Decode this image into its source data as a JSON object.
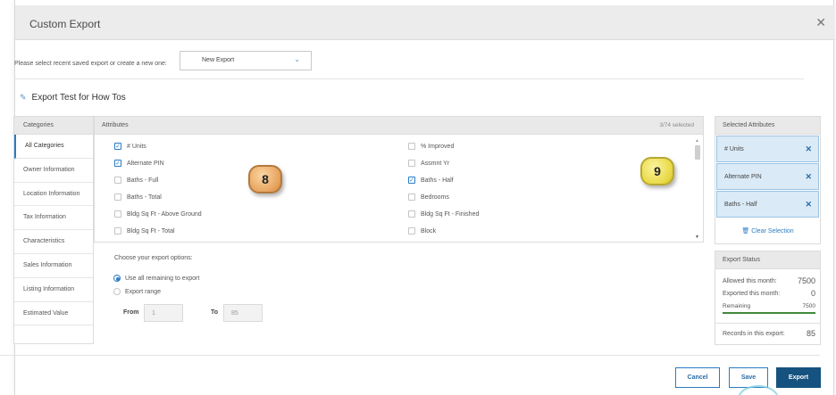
{
  "dialog": {
    "title": "Custom Export"
  },
  "select_row": {
    "prompt": "Please select recent saved export or create a new one:",
    "selected": "New Export"
  },
  "export_name": "Export Test for How Tos",
  "categories": {
    "header": "Categories",
    "items": [
      "All Categories",
      "Owner Information",
      "Location Information",
      "Tax Information",
      "Characteristics",
      "Sales Information",
      "Listing Information",
      "Estimated Value"
    ]
  },
  "attributes": {
    "header": "Attributes",
    "count": "3/74 selected",
    "left": [
      {
        "label": "# Units",
        "checked": true
      },
      {
        "label": "Alternate PIN",
        "checked": true
      },
      {
        "label": "Baths - Full",
        "checked": false
      },
      {
        "label": "Baths - Total",
        "checked": false
      },
      {
        "label": "Bldg Sq Ft - Above Ground",
        "checked": false
      },
      {
        "label": "Bldg Sq Ft - Total",
        "checked": false
      }
    ],
    "right": [
      {
        "label": "% Improved",
        "checked": false
      },
      {
        "label": "Assmnt Yr",
        "checked": false
      },
      {
        "label": "Baths - Half",
        "checked": true
      },
      {
        "label": "Bedrooms",
        "checked": false
      },
      {
        "label": "Bldg Sq Ft - Finished",
        "checked": false
      },
      {
        "label": "Block",
        "checked": false
      }
    ]
  },
  "callouts": {
    "eight": "8",
    "nine": "9"
  },
  "options": {
    "title": "Choose your export options:",
    "use_all": "Use all remaining to export",
    "range": "Export range",
    "from_label": "From",
    "from_value": "1",
    "to_label": "To",
    "to_value": "85"
  },
  "selected_attributes": {
    "header": "Selected Attributes",
    "items": [
      "# Units",
      "Alternate PIN",
      "Baths - Half"
    ],
    "clear": "Clear Selection"
  },
  "export_status": {
    "header": "Export Status",
    "allowed_label": "Allowed this month:",
    "allowed_value": "7500",
    "exported_label": "Exported this month:",
    "exported_value": "0",
    "remaining_label": "Remaining",
    "remaining_value": "7500",
    "records_label": "Records in this export:",
    "records_value": "85"
  },
  "buttons": {
    "cancel": "Cancel",
    "save": "Save",
    "export": "Export"
  },
  "colors": {
    "accent": "#2b7bc3",
    "primary_button": "#15527f",
    "selected_bg": "#daeaf6",
    "progress": "#3f8a3a"
  }
}
